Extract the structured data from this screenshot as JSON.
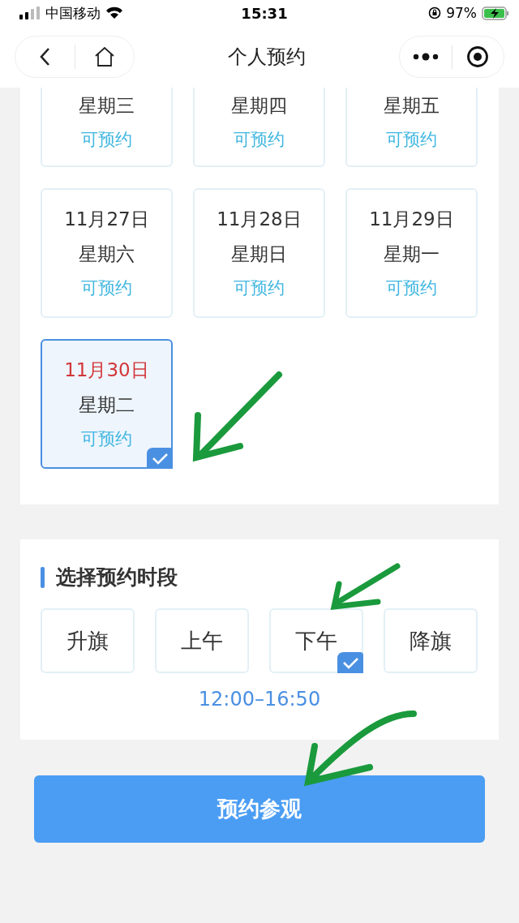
{
  "status_bar": {
    "carrier": "中国移动",
    "time": "15:31",
    "battery": "97%"
  },
  "nav": {
    "title": "个人预约"
  },
  "dates": [
    {
      "weekday": "星期三",
      "status": "可预约",
      "selected": false
    },
    {
      "weekday": "星期四",
      "status": "可预约",
      "selected": false
    },
    {
      "weekday": "星期五",
      "status": "可预约",
      "selected": false
    },
    {
      "date": "11月27日",
      "weekday": "星期六",
      "status": "可预约",
      "selected": false
    },
    {
      "date": "11月28日",
      "weekday": "星期日",
      "status": "可预约",
      "selected": false
    },
    {
      "date": "11月29日",
      "weekday": "星期一",
      "status": "可预约",
      "selected": false
    },
    {
      "date": "11月30日",
      "weekday": "星期二",
      "status": "可预约",
      "selected": true
    }
  ],
  "time_section": {
    "title": "选择预约时段",
    "slots": [
      {
        "label": "升旗",
        "selected": false
      },
      {
        "label": "上午",
        "selected": false
      },
      {
        "label": "下午",
        "selected": true
      },
      {
        "label": "降旗",
        "selected": false
      }
    ],
    "time_range": "12:00–16:50"
  },
  "submit_button": "预约参观"
}
